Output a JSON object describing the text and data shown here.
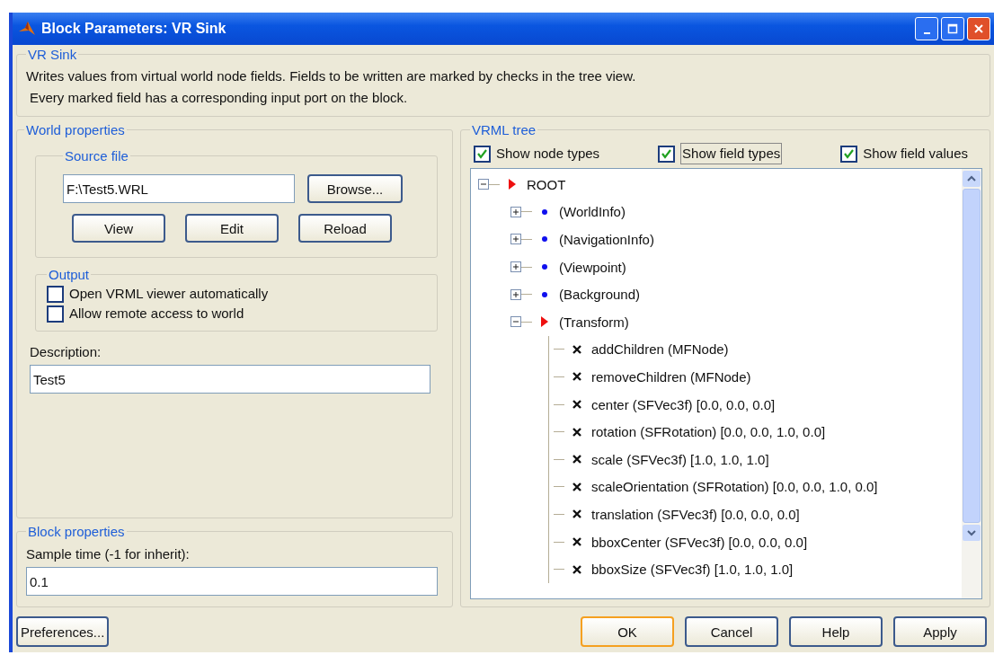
{
  "window": {
    "title": "Block Parameters: VR Sink"
  },
  "header": {
    "title": "VR Sink",
    "lines": [
      "Writes values from virtual world node fields. Fields to be written are marked by checks in the tree view.",
      "Every marked field has a corresponding input port on the block."
    ]
  },
  "world_properties": {
    "title": "World properties",
    "source_file": {
      "title": "Source file",
      "path": "F:\\Test5.WRL",
      "browse": "Browse...",
      "buttons": [
        "View",
        "Edit",
        "Reload"
      ]
    },
    "output": {
      "title": "Output",
      "options": [
        {
          "label": "Open VRML viewer automatically",
          "checked": false
        },
        {
          "label": "Allow remote access to world",
          "checked": false
        }
      ]
    },
    "description": {
      "label": "Description:",
      "value": "Test5"
    }
  },
  "block_properties": {
    "title": "Block properties",
    "label": "Sample time (-1 for inherit):",
    "value": "0.1"
  },
  "vrml_tree": {
    "title": "VRML tree",
    "options": [
      {
        "label": "Show node types",
        "checked": true,
        "focused": false
      },
      {
        "label": "Show field types",
        "checked": true,
        "focused": true
      },
      {
        "label": "Show field values",
        "checked": true,
        "focused": false
      }
    ],
    "nodes": [
      {
        "label": "ROOT",
        "kind": "group",
        "expanded": true,
        "children": [
          {
            "label": "(WorldInfo)",
            "kind": "node",
            "expanded": false
          },
          {
            "label": "(NavigationInfo)",
            "kind": "node",
            "expanded": false
          },
          {
            "label": "(Viewpoint)",
            "kind": "node",
            "expanded": false
          },
          {
            "label": "(Background)",
            "kind": "node",
            "expanded": false
          },
          {
            "label": "(Transform)",
            "kind": "group",
            "expanded": true,
            "children": [
              {
                "label": "addChildren (MFNode)",
                "kind": "field"
              },
              {
                "label": "removeChildren (MFNode)",
                "kind": "field"
              },
              {
                "label": "center (SFVec3f) [0.0, 0.0, 0.0]",
                "kind": "field"
              },
              {
                "label": "rotation (SFRotation) [0.0, 0.0, 1.0, 0.0]",
                "kind": "field"
              },
              {
                "label": "scale (SFVec3f) [1.0, 1.0, 1.0]",
                "kind": "field"
              },
              {
                "label": "scaleOrientation (SFRotation) [0.0, 0.0, 1.0, 0.0]",
                "kind": "field"
              },
              {
                "label": "translation (SFVec3f) [0.0, 0.0, 0.0]",
                "kind": "field"
              },
              {
                "label": "bboxCenter (SFVec3f) [0.0, 0.0, 0.0]",
                "kind": "field"
              },
              {
                "label": "bboxSize (SFVec3f) [1.0, 1.0, 1.0]",
                "kind": "field"
              }
            ]
          }
        ]
      }
    ]
  },
  "footer": {
    "preferences": "Preferences...",
    "buttons": [
      {
        "label": "OK",
        "default": true
      },
      {
        "label": "Cancel",
        "default": false
      },
      {
        "label": "Help",
        "default": false
      },
      {
        "label": "Apply",
        "default": false
      }
    ]
  }
}
